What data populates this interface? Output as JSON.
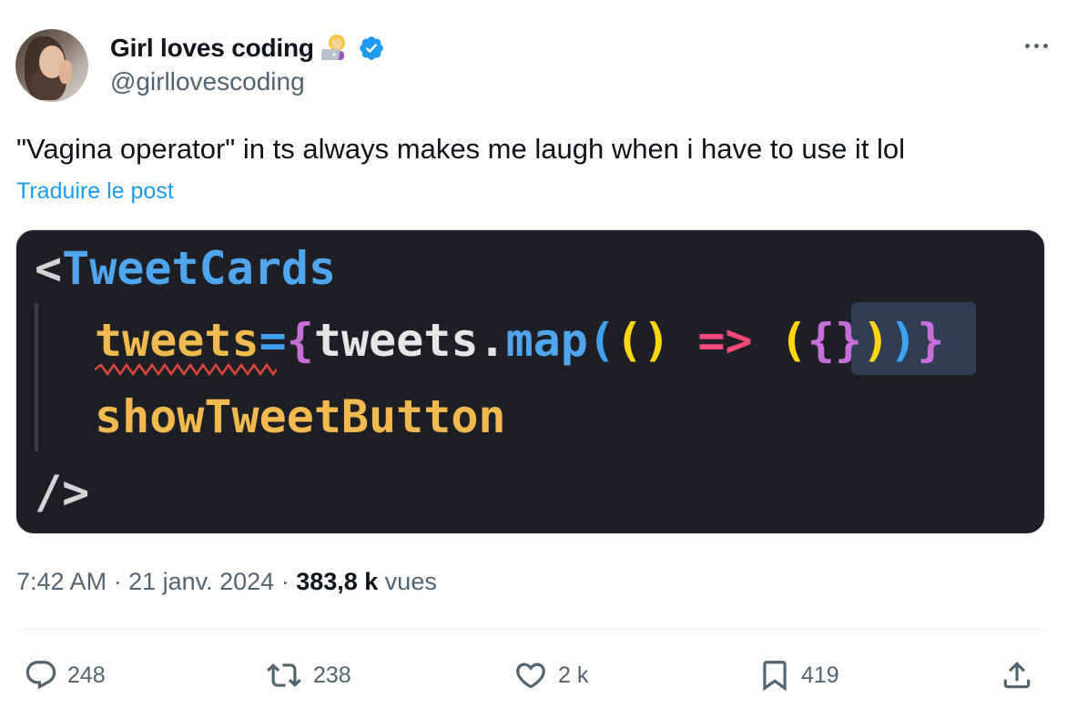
{
  "author": {
    "display_name": "Girl loves coding",
    "handle": "@girllovescoding",
    "emoji": "woman-technologist",
    "verified": true
  },
  "post": {
    "text": "\"Vagina operator\" in ts always makes me laugh when i have to use it lol",
    "translate_label": "Traduire le post"
  },
  "code_image": {
    "line1": {
      "punct": "<",
      "tag": "TweetCards"
    },
    "line2": {
      "attr": "tweets",
      "eq": "=",
      "brace_open": "{",
      "obj": "tweets",
      "dot": ".",
      "fn": "map",
      "p1": "(",
      "p2": "()",
      "arrow": " => ",
      "p3": "(",
      "inner": "{}",
      "p4": ")",
      "p5": ")",
      "brace_close": "}"
    },
    "line3": {
      "attr": "showTweetButton"
    },
    "line4": {
      "punct": "/>"
    }
  },
  "meta": {
    "time": "7:42 AM",
    "sep1": " · ",
    "date": "21 janv. 2024",
    "sep2": " · ",
    "views_count": "383,8 k",
    "views_label": " vues"
  },
  "actions": {
    "replies": "248",
    "reposts": "238",
    "likes": "2 k",
    "bookmarks": "419"
  },
  "colors": {
    "link": "#1d9bf0",
    "verified": "#1d9bf0",
    "muted": "#536471",
    "code_bg": "#1e1f25"
  }
}
